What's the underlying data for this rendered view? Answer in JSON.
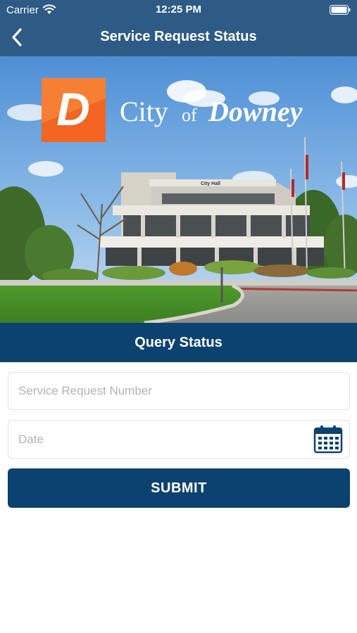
{
  "status_bar": {
    "carrier": "Carrier",
    "time": "12:25 PM"
  },
  "nav": {
    "title": "Service Request Status",
    "back_icon": "chevron-left-icon"
  },
  "hero": {
    "logo_letter": "D",
    "logo_text_city": "City",
    "logo_text_of": "of",
    "logo_text_name": "Downey",
    "building_sign": "City Hall"
  },
  "section": {
    "title": "Query Status"
  },
  "form": {
    "service_request_placeholder": "Service Request Number",
    "service_request_value": "",
    "date_placeholder": "Date",
    "date_value": "",
    "calendar_icon": "calendar-icon",
    "submit_label": "SUBMIT"
  },
  "colors": {
    "header": "#2e5b85",
    "primary": "#0c426f",
    "logo_orange": "#f26522"
  }
}
